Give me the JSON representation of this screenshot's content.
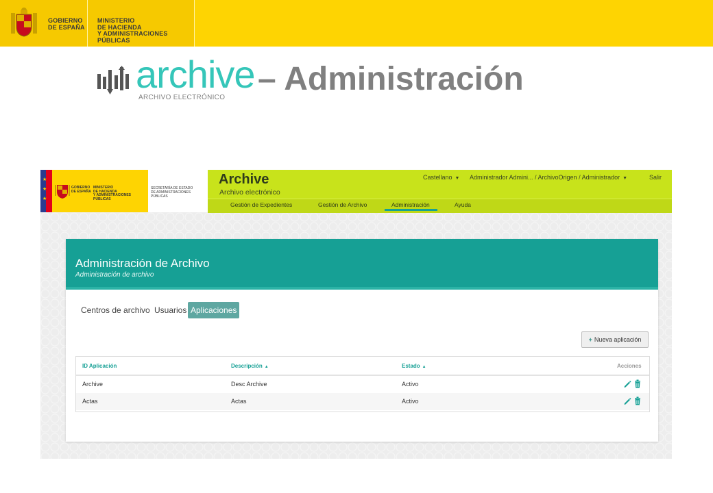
{
  "banner": {
    "gobierno": "GOBIERNO\nDE ESPAÑA",
    "ministerio": "MINISTERIO\nDE HACIENDA\nY ADMINISTRACIONES PÚBLICAS"
  },
  "slide_title": {
    "logo_word": "archive",
    "logo_sub": "ARCHIVO ELECTRÓNICO",
    "rest": "– Administración"
  },
  "app": {
    "gob_text": "GOBIERNO\nDE ESPAÑA",
    "min_text": "MINISTERIO\nDE HACIENDA\nY ADMINISTRACIONES PÚBLICAS",
    "sec_text": "SECRETARÍA DE ESTADO\nDE ADMINISTRACIONES PÚBLICAS",
    "name": "Archive",
    "subtitle": "Archivo electrónico",
    "top_menu": {
      "language": "Castellano",
      "user": "Administrador Admini... / ArchivoOrigen / Administrador",
      "logout": "Salir"
    },
    "nav": [
      {
        "label": "Gestión de Expedientes"
      },
      {
        "label": "Gestión de Archivo"
      },
      {
        "label": "Administración"
      },
      {
        "label": "Ayuda"
      }
    ],
    "panel": {
      "title": "Administración de Archivo",
      "subtitle": "Administración de archivo",
      "tabs": [
        {
          "label": "Centros de archivo"
        },
        {
          "label": "Usuarios"
        },
        {
          "label": "Aplicaciones"
        }
      ],
      "new_button": "Nueva aplicación",
      "table": {
        "headers": [
          "ID Aplicación",
          "Descripción",
          "Estado",
          "Acciones"
        ],
        "rows": [
          {
            "id": "Archive",
            "desc": "Desc Archive",
            "estado": "Activo"
          },
          {
            "id": "Actas",
            "desc": "Actas",
            "estado": "Activo"
          }
        ]
      }
    }
  },
  "colors": {
    "banner_yellow": "#fed402",
    "app_green": "#c8e31b",
    "teal": "#16a095",
    "logo_teal": "#35c6b9",
    "title_gray": "#808080"
  }
}
